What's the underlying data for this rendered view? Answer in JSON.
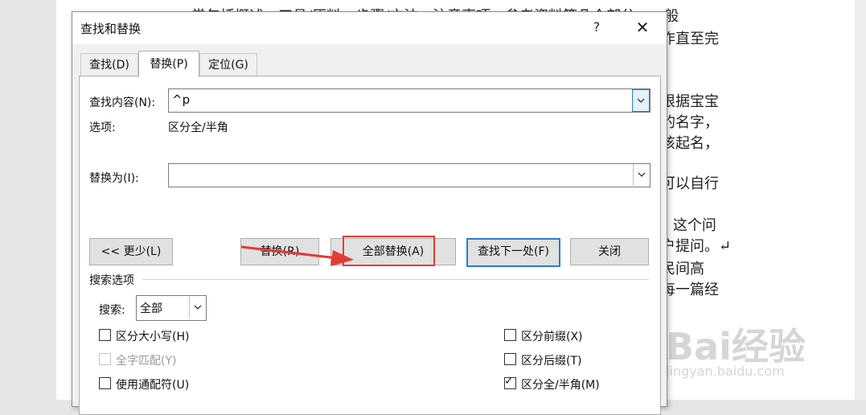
{
  "document": {
    "lines": [
      "…常包括概述、工具/原料、步骤/方法、注意事项、参考资料等几个部分，一般",
      "作直至完",
      "根据宝宝",
      "的名字，",
      "该起名，",
      "可以自行",
      "” 这个问",
      "户提问。↵",
      "民间高",
      "每一篇经"
    ]
  },
  "dialog": {
    "title": "查找和替换",
    "help": "?",
    "close": "✕",
    "tabs": [
      {
        "label": "查找(D)"
      },
      {
        "label": "替换(P)"
      },
      {
        "label": "定位(G)"
      }
    ],
    "find": {
      "label": "查找内容(N):",
      "value": "^p",
      "options_label": "选项:",
      "options_value": "区分全/半角"
    },
    "replace": {
      "label": "替换为(I):",
      "value": ""
    },
    "buttons": {
      "less": "<< 更少(L)",
      "replace": "替换(R)",
      "replace_all": "全部替换(A)",
      "find_next": "查找下一处(F)",
      "close": "关闭"
    },
    "search_options": {
      "heading": "搜索选项",
      "search_label": "搜索:",
      "search_value": "全部"
    },
    "checkboxes": {
      "match_case": {
        "label": "区分大小写(H)",
        "checked": false
      },
      "whole_word": {
        "label": "全字匹配(Y)",
        "checked": false,
        "disabled": true
      },
      "wildcards": {
        "label": "使用通配符(U)",
        "checked": false
      },
      "prefix": {
        "label": "区分前缀(X)",
        "checked": false
      },
      "suffix": {
        "label": "区分后缀(T)",
        "checked": false
      },
      "width": {
        "label": "区分全/半角(M)",
        "checked": true,
        "check_mark": "✓"
      }
    }
  },
  "watermark": {
    "brand": "Bai经验",
    "url": "jingyan.baidu.com"
  },
  "colors": {
    "highlight_box": "#e53935",
    "arrow": "#e53935",
    "focus_blue": "#2a7bd6"
  }
}
